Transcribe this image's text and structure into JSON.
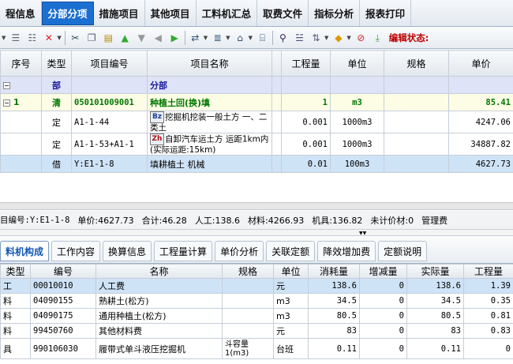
{
  "menu_tabs": [
    "程信息",
    "分部分项",
    "措施项目",
    "其他项目",
    "工料机汇总",
    "取费文件",
    "指标分析",
    "报表打印"
  ],
  "toolbar": {
    "status_label": "编辑状态:"
  },
  "grid1": {
    "headers": [
      "序号",
      "类型",
      "项目编号",
      "项目名称",
      "",
      "工程量",
      "单位",
      "规格",
      "单价"
    ],
    "part_row": {
      "type": "部",
      "name": "分部"
    },
    "item_row": {
      "seq": "1",
      "type": "清",
      "code": "050101009001",
      "name": "种植土回(换)填",
      "qty": "1",
      "unit": "m3",
      "price": "85.41"
    },
    "sub_rows": [
      {
        "type": "定",
        "code": "A1-1-44",
        "badge": "Bz",
        "name": "挖掘机挖装一般土方 一、二类土",
        "qty": "0.001",
        "unit": "1000m3",
        "price": "4247.06"
      },
      {
        "type": "定",
        "code": "A1-1-53+A1-1",
        "badge": "Zh",
        "name": "自卸汽车运土方 运距1km内(实际运距:15km)",
        "qty": "0.001",
        "unit": "1000m3",
        "price": "34887.82"
      },
      {
        "type": "借",
        "code": "Y:E1-1-8",
        "badge": "",
        "name": "填耕植土 机械",
        "qty": "0.01",
        "unit": "100m3",
        "price": "4627.73"
      }
    ]
  },
  "summary": {
    "code": "目编号:Y:E1-1-8",
    "unit_price": "单价:4627.73",
    "total": "合计:46.28",
    "labor": "人工:138.6",
    "material": "材料:4266.93",
    "machine": "机具:136.82",
    "unpriced": "未计价材:0",
    "mgmt": "管理费"
  },
  "lower_tabs": [
    "料机构成",
    "工作内容",
    "换算信息",
    "工程量计算",
    "单价分析",
    "关联定额",
    "降效增加费",
    "定额说明"
  ],
  "grid2": {
    "headers": [
      "类型",
      "编号",
      "名称",
      "规格",
      "单位",
      "消耗量",
      "增减量",
      "实际量",
      "工程量"
    ],
    "rows": [
      {
        "type": "工",
        "code": "00010010",
        "name": "人工费",
        "spec": "",
        "unit": "元",
        "consume": "138.6",
        "delta": "0",
        "actual": "138.6",
        "qty": "1.39"
      },
      {
        "type": "料",
        "code": "04090155",
        "name": "熟耕土(松方)",
        "spec": "",
        "unit": "m3",
        "consume": "34.5",
        "delta": "0",
        "actual": "34.5",
        "qty": "0.35"
      },
      {
        "type": "料",
        "code": "04090175",
        "name": "通用种植土(松方)",
        "spec": "",
        "unit": "m3",
        "consume": "80.5",
        "delta": "0",
        "actual": "80.5",
        "qty": "0.81"
      },
      {
        "type": "料",
        "code": "99450760",
        "name": "其他材料费",
        "spec": "",
        "unit": "元",
        "consume": "83",
        "delta": "0",
        "actual": "83",
        "qty": "0.83"
      },
      {
        "type": "具",
        "code": "990106030",
        "name": "履带式单斗液压挖掘机",
        "spec": "斗容量1(m3)",
        "unit": "台班",
        "consume": "0.11",
        "delta": "0",
        "actual": "0.11",
        "qty": "0"
      }
    ]
  },
  "colors": {
    "accent": "#1b6fd0",
    "selection": "#cfe3f7",
    "status_red": "#b00000",
    "item_green": "#007700"
  }
}
